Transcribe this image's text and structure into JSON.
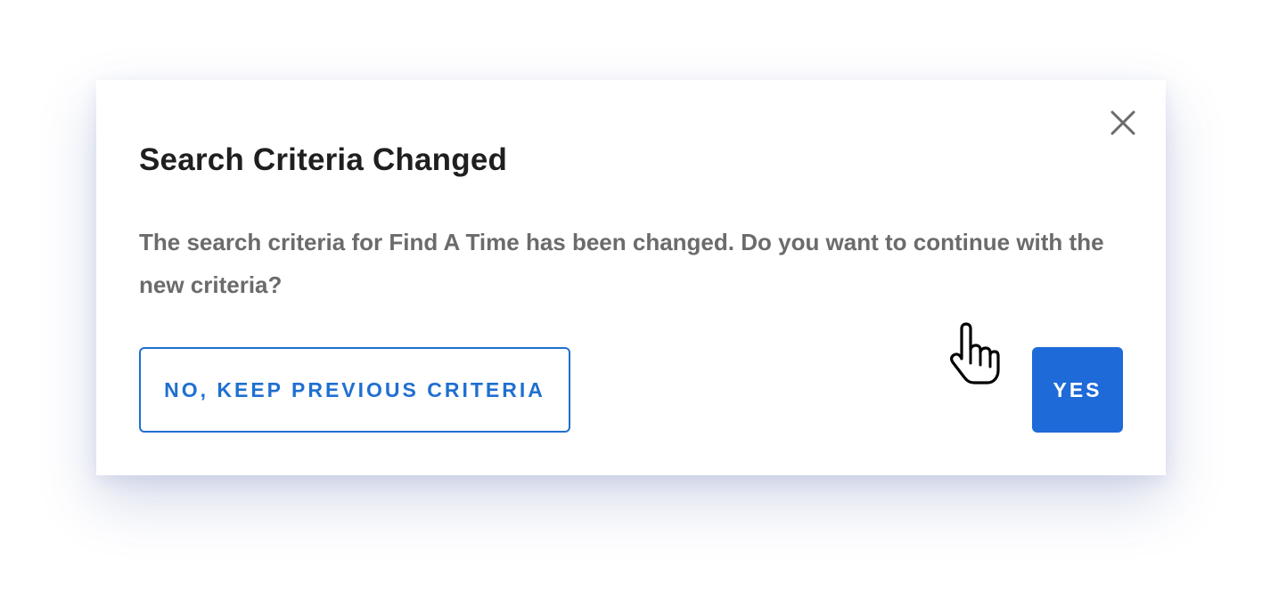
{
  "dialog": {
    "title": "Search Criteria Changed",
    "message": "The search criteria for Find A Time has been changed. Do you want to continue with the new criteria?",
    "close_icon": "close-icon",
    "buttons": {
      "secondary_label": "NO, KEEP PREVIOUS CRITERIA",
      "primary_label": "YES"
    }
  },
  "cursor": {
    "icon": "hand-pointer-icon"
  },
  "colors": {
    "accent": "#1e6ad8",
    "title_text": "#1f1f1f",
    "body_text": "#6b6b6b",
    "close_icon": "#6b6b6b"
  }
}
